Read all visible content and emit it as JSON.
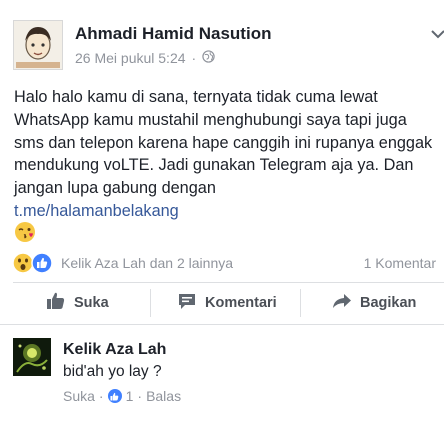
{
  "post": {
    "author": "Ahmadi Hamid Nasution",
    "timestamp": "26 Mei pukul 5:24",
    "separator": "·",
    "privacy_icon": "globe-icon",
    "more_icon": "chevron-down-icon",
    "body": "Halo halo kamu di sana, ternyata tidak cuma lewat WhatsApp kamu mustahil menghubungi saya tapi juga sms dan telepon karena hape canggih ini rupanya enggak mendukung voLTE. Jadi gunakan Telegram aja ya. Dan jangan lupa gabung dengan",
    "link": "t.me/halamanbelakang",
    "emoji": "kiss-wink-emoji"
  },
  "reactions": {
    "icons": [
      "wow-reaction-icon",
      "like-reaction-icon"
    ],
    "names": "Kelik Aza Lah dan 2 lainnya",
    "comment_count": "1 Komentar"
  },
  "actions": {
    "like": "Suka",
    "comment": "Komentari",
    "share": "Bagikan"
  },
  "comment": {
    "author": "Kelik Aza Lah",
    "text": "bid'ah yo lay ?",
    "like_label": "Suka",
    "dot": "·",
    "like_count": "1",
    "reply_label": "Balas"
  },
  "colors": {
    "link": "#365899",
    "secondary_text": "#90949c",
    "like_blue": "#4080ff",
    "reaction_yellow": "#f7c844"
  }
}
